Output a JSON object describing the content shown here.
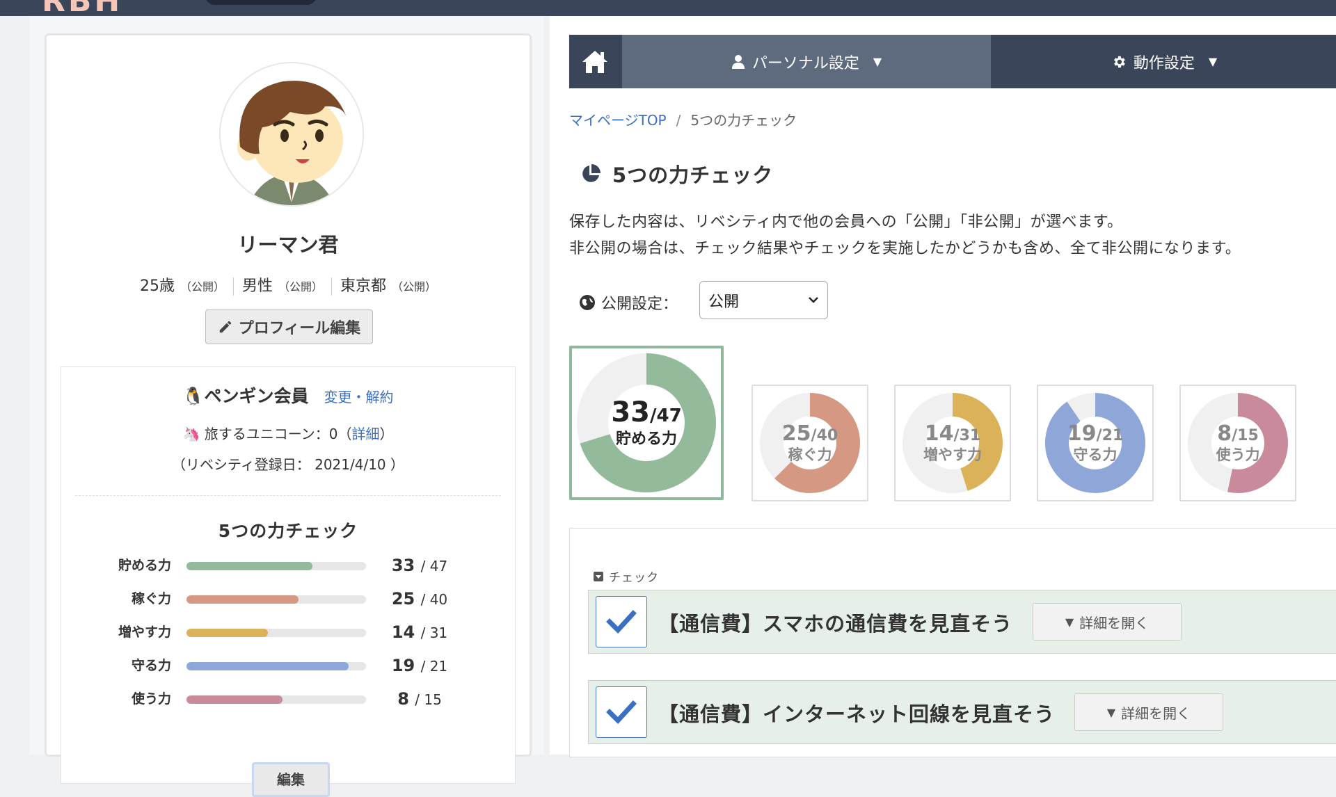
{
  "header": {
    "logo_text": "RBH"
  },
  "profile": {
    "name": "リーマン君",
    "age": "25歳",
    "age_vis": "（公開）",
    "gender": "男性",
    "gender_vis": "（公開）",
    "location": "東京都",
    "location_vis": "（公開）",
    "edit_label": "プロフィール編集"
  },
  "membership": {
    "title": "🐧ペンギン会員",
    "change_link": "変更・解約",
    "unicorn_prefix": "🦄 旅するユニコーン：0（",
    "unicorn_link": "詳細",
    "unicorn_suffix": "）",
    "register_text": "（リベシティ登録日： 2021/4/10 ）"
  },
  "mini_check": {
    "title": "5つの力チェック",
    "edit_label": "編集",
    "rows": [
      {
        "label": "貯める力",
        "score": "33",
        "total": "/ 47",
        "value": 33,
        "max": 47,
        "color": "#93bb9b"
      },
      {
        "label": "稼ぐ力",
        "score": "25",
        "total": "/ 40",
        "value": 25,
        "max": 40,
        "color": "#d49883"
      },
      {
        "label": "増やす力",
        "score": "14",
        "total": "/ 31",
        "value": 14,
        "max": 31,
        "color": "#dbb25a"
      },
      {
        "label": "守る力",
        "score": "19",
        "total": "/ 21",
        "value": 19,
        "max": 21,
        "color": "#8ea7d8"
      },
      {
        "label": "使う力",
        "score": "8",
        "total": "/ 15",
        "value": 8,
        "max": 15,
        "color": "#c98a9c"
      }
    ]
  },
  "nav": {
    "personal_label": "パーソナル設定",
    "action_label": "動作設定",
    "caret": "▼"
  },
  "breadcrumb": {
    "home": "マイページTOP",
    "sep": "/",
    "current": "5つの力チェック"
  },
  "page": {
    "title": "5つの力チェック",
    "desc1": "保存した内容は、リベシティ内で他の会員への「公開」「非公開」が選べます。",
    "desc2": "非公開の場合は、チェック結果やチェックを実施したかどうかも含め、全て非公開になります。",
    "privacy_label": "公開設定：",
    "privacy_value": "公開"
  },
  "donuts": [
    {
      "label": "貯める力",
      "score": "33",
      "total": "/47",
      "value": 33,
      "max": 47,
      "color": "#93bb9b",
      "active": true
    },
    {
      "label": "稼ぐ力",
      "score": "25",
      "total": "/40",
      "value": 25,
      "max": 40,
      "color": "#d49883",
      "active": false
    },
    {
      "label": "増やす力",
      "score": "14",
      "total": "/31",
      "value": 14,
      "max": 31,
      "color": "#dbb25a",
      "active": false
    },
    {
      "label": "守る力",
      "score": "19",
      "total": "/21",
      "value": 19,
      "max": 21,
      "color": "#8ea7d8",
      "active": false
    },
    {
      "label": "使う力",
      "score": "8",
      "total": "/15",
      "value": 8,
      "max": 15,
      "color": "#c98a9c",
      "active": false
    }
  ],
  "checks": {
    "heading": "チェック",
    "items": [
      {
        "title": "【通信費】スマホの通信費を見直そう",
        "detail": "詳細を開く",
        "checked": true
      },
      {
        "title": "【通信費】インターネット回線を見直そう",
        "detail": "詳細を開く",
        "checked": true
      }
    ]
  },
  "colors": {
    "nav_dark": "#3b4559",
    "nav_active": "#5e6b7e",
    "link": "#3a6fc1",
    "check_bg": "#e6efe8"
  }
}
